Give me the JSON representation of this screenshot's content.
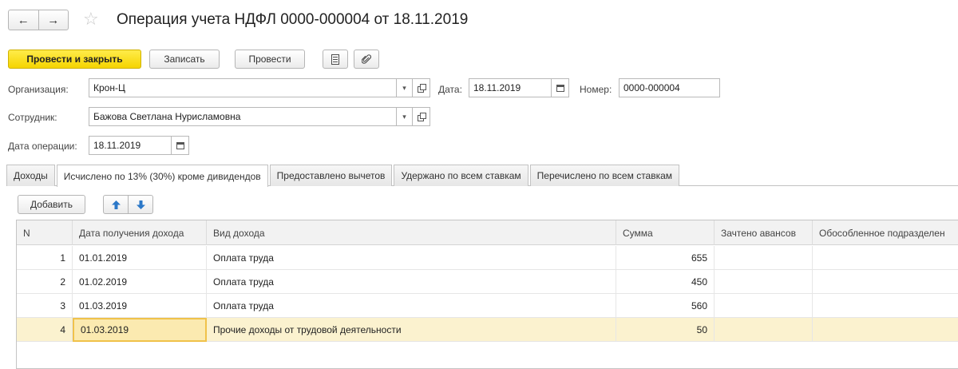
{
  "window": {
    "title": "Операция учета НДФЛ 0000-000004 от 18.11.2019",
    "back_icon": "←",
    "forward_icon": "→",
    "star_icon": "☆"
  },
  "toolbar": {
    "post_close_label": "Провести и закрыть",
    "save_label": "Записать",
    "post_label": "Провести"
  },
  "form": {
    "organization_label": "Организация:",
    "organization_value": "Крон-Ц",
    "date_label": "Дата:",
    "date_value": "18.11.2019",
    "number_label": "Номер:",
    "number_value": "0000-000004",
    "employee_label": "Сотрудник:",
    "employee_value": "Бажова Светлана Нурисламовна",
    "operation_date_label": "Дата операции:",
    "operation_date_value": "18.11.2019"
  },
  "tabs": [
    {
      "label": "Доходы"
    },
    {
      "label": "Исчислено по 13% (30%) кроме дивидендов"
    },
    {
      "label": "Предоставлено вычетов"
    },
    {
      "label": "Удержано по всем ставкам"
    },
    {
      "label": "Перечислено по всем ставкам"
    }
  ],
  "active_tab": 1,
  "table": {
    "add_label": "Добавить",
    "up_icon": "🡅",
    "down_icon": "🡇",
    "headers": [
      "N",
      "Дата получения дохода",
      "Вид дохода",
      "Сумма",
      "Зачтено авансов",
      "Обособленное подразделен"
    ],
    "rows": [
      {
        "n": "1",
        "date": "01.01.2019",
        "type": "Оплата труда",
        "sum": "655",
        "advances": "",
        "division": ""
      },
      {
        "n": "2",
        "date": "01.02.2019",
        "type": "Оплата труда",
        "sum": "450",
        "advances": "",
        "division": ""
      },
      {
        "n": "3",
        "date": "01.03.2019",
        "type": "Оплата труда",
        "sum": "560",
        "advances": "",
        "division": ""
      },
      {
        "n": "4",
        "date": "01.03.2019",
        "type": "Прочие доходы от трудовой деятельности",
        "sum": "50",
        "advances": "",
        "division": ""
      }
    ],
    "selected_row": 3
  },
  "colors": {
    "primary_button": "#f5d400",
    "selected_row": "#fbf2cf",
    "focus_cell": "#f0c24a",
    "arrow_blue": "#2b78c8"
  }
}
